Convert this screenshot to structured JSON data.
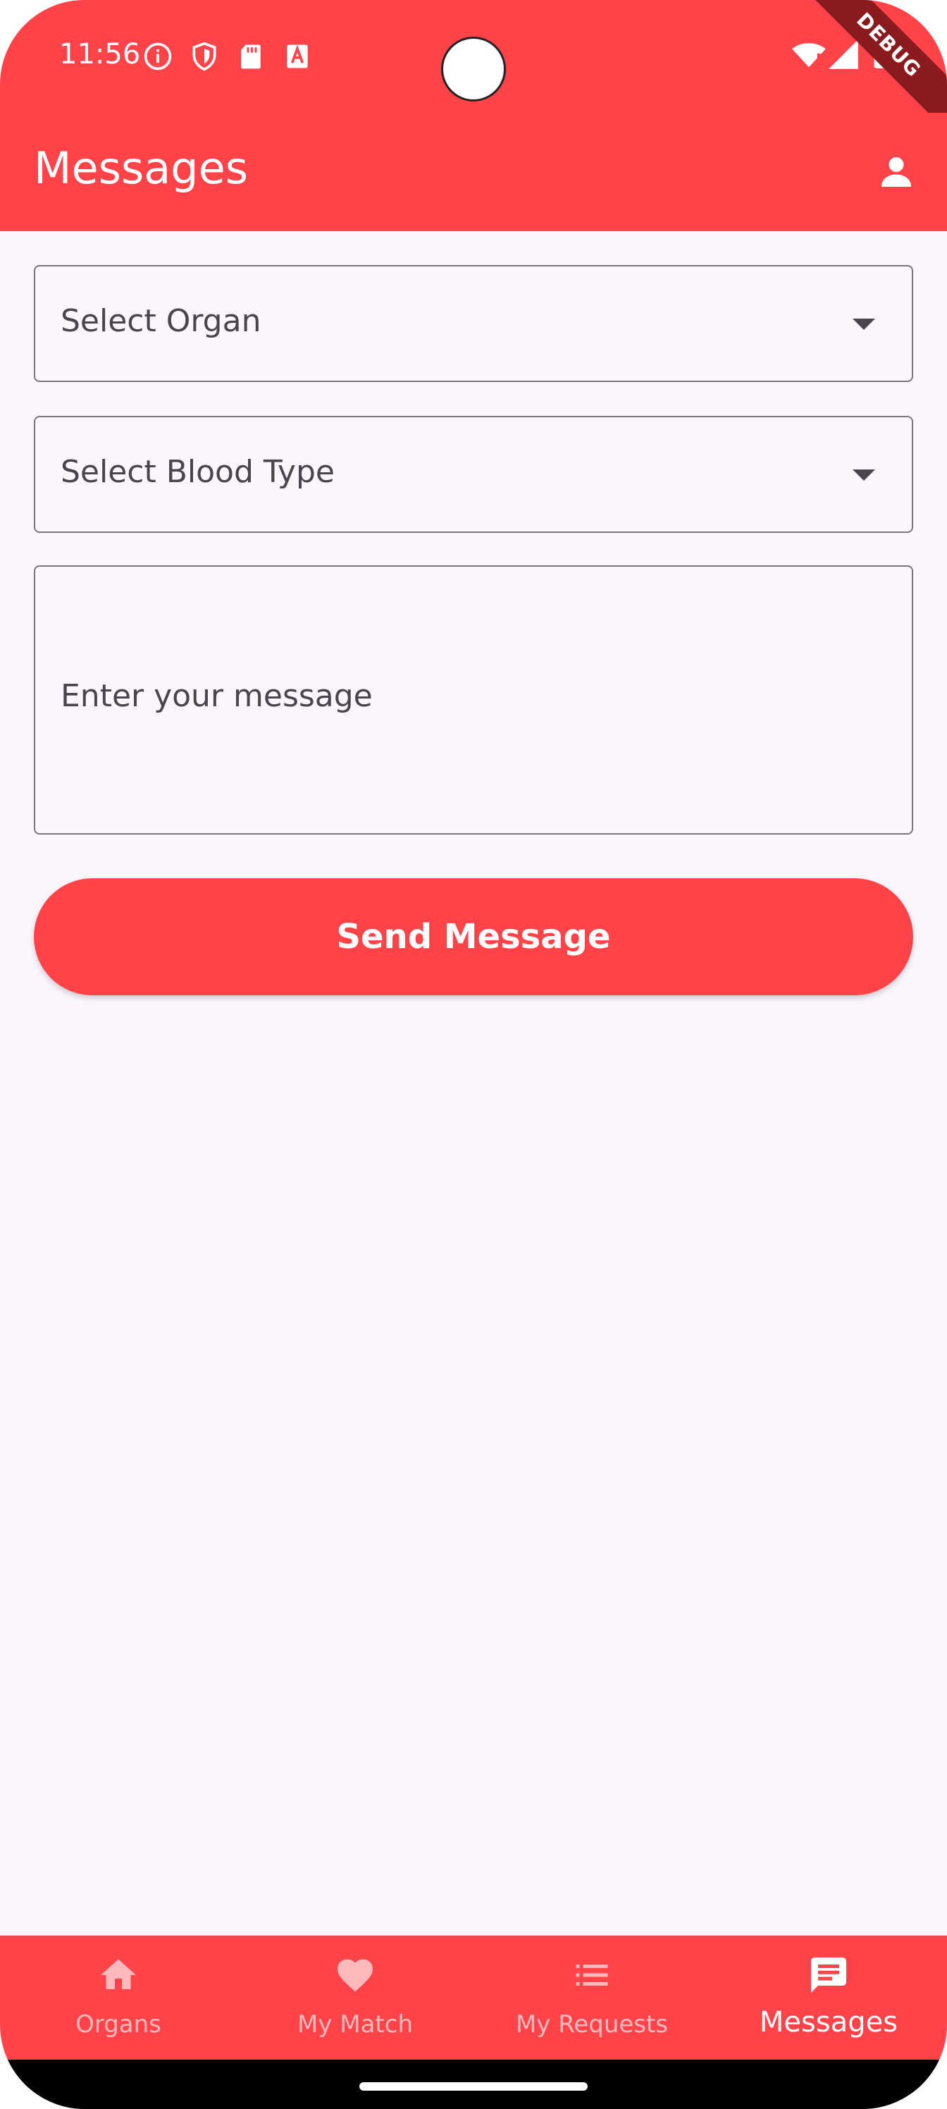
{
  "status_bar": {
    "time": "11:56",
    "debug_label": "DEBUG"
  },
  "app_bar": {
    "title": "Messages"
  },
  "form": {
    "organ_select": {
      "placeholder": "Select Organ"
    },
    "blood_type_select": {
      "placeholder": "Select Blood Type"
    },
    "message_input": {
      "placeholder": "Enter your message",
      "value": ""
    },
    "send_label": "Send Message"
  },
  "bottom_nav": {
    "items": [
      {
        "label": "Organs",
        "icon": "home-icon"
      },
      {
        "label": "My Match",
        "icon": "heart-icon"
      },
      {
        "label": "My Requests",
        "icon": "list-icon"
      },
      {
        "label": "Messages",
        "icon": "message-icon",
        "active": true
      }
    ]
  },
  "colors": {
    "primary": "#ff4349",
    "background": "#fcf5fc",
    "inactive_nav": "#ffb9bc",
    "field_border": "#79747e"
  }
}
